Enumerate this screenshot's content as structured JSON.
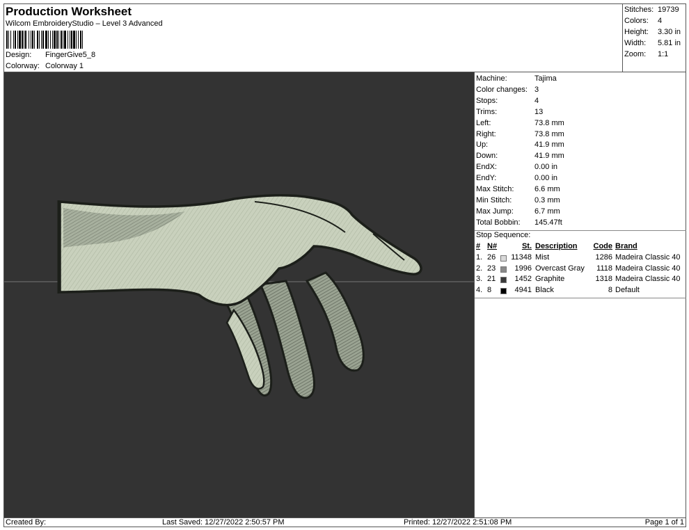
{
  "header": {
    "title": "Production Worksheet",
    "subtitle": "Wilcom EmbroideryStudio – Level 3 Advanced",
    "design_label": "Design:",
    "design_value": "FingerGive5_8",
    "colorway_label": "Colorway:",
    "colorway_value": "Colorway 1"
  },
  "stats": [
    {
      "label": "Stitches:",
      "value": "19739"
    },
    {
      "label": "Colors:",
      "value": "4"
    },
    {
      "label": "Height:",
      "value": "3.30 in"
    },
    {
      "label": "Width:",
      "value": "5.81 in"
    },
    {
      "label": "Zoom:",
      "value": "1:1"
    }
  ],
  "properties": [
    {
      "label": "Machine:",
      "value": "Tajima"
    },
    {
      "label": "Color changes:",
      "value": "3"
    },
    {
      "label": "Stops:",
      "value": "4"
    },
    {
      "label": "Trims:",
      "value": "13"
    },
    {
      "label": "Left:",
      "value": "73.8 mm"
    },
    {
      "label": "Right:",
      "value": "73.8 mm"
    },
    {
      "label": "Up:",
      "value": "41.9 mm"
    },
    {
      "label": "Down:",
      "value": "41.9 mm"
    },
    {
      "label": "EndX:",
      "value": "0.00 in"
    },
    {
      "label": "EndY:",
      "value": "0.00 in"
    },
    {
      "label": "Max Stitch:",
      "value": "6.6 mm"
    },
    {
      "label": "Min Stitch:",
      "value": "0.3 mm"
    },
    {
      "label": "Max Jump:",
      "value": "6.7 mm"
    },
    {
      "label": "Total Bobbin:",
      "value": "145.47ft"
    }
  ],
  "stop_sequence": {
    "title": "Stop Sequence:",
    "headers": {
      "num": "#",
      "n": "N#",
      "st": "St.",
      "description": "Description",
      "code": "Code",
      "brand": "Brand"
    },
    "rows": [
      {
        "num": "1.",
        "n": "26",
        "color": "#d9d9d9",
        "st": "11348",
        "description": "Mist",
        "code": "1286",
        "brand": "Madeira Classic 40"
      },
      {
        "num": "2.",
        "n": "23",
        "color": "#8a8a8a",
        "st": "1996",
        "description": "Overcast Gray",
        "code": "1118",
        "brand": "Madeira Classic 40"
      },
      {
        "num": "3.",
        "n": "21",
        "color": "#3a3a3a",
        "st": "1452",
        "description": "Graphite",
        "code": "1318",
        "brand": "Madeira Classic 40"
      },
      {
        "num": "4.",
        "n": "8",
        "color": "#000000",
        "st": "4941",
        "description": "Black",
        "code": "8",
        "brand": "Default"
      }
    ]
  },
  "footer": {
    "created_by": "Created By:",
    "last_saved": "Last Saved: 12/27/2022 2:50:57 PM",
    "printed": "Printed: 12/27/2022 2:51:08 PM",
    "page": "Page 1 of 1"
  },
  "colors": {
    "canvas_bg": "#333333",
    "thread_light": "#c9d1bd",
    "thread_mid": "#9aa392",
    "thread_dark": "#5e6558",
    "outline": "#1c1f1a"
  }
}
